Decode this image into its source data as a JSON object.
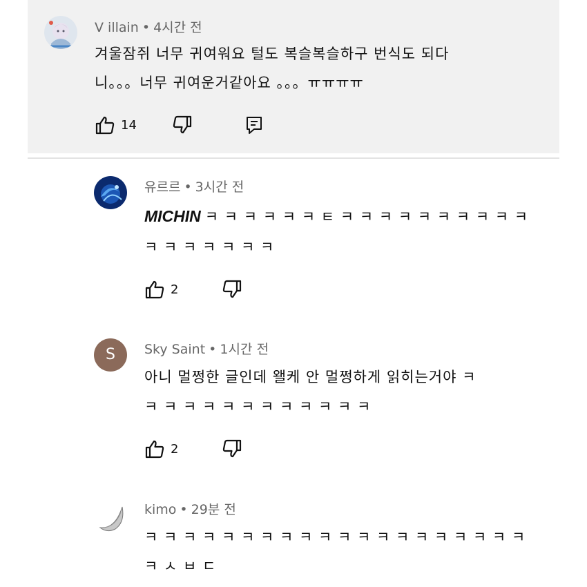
{
  "comments": [
    {
      "author": "V illain",
      "separator": "•",
      "time": "4시간 전",
      "lines": [
        "겨울잠쥐 너무 귀여워요 털도 복슬복슬하구 번식도 되다",
        "니。。。너무 귀여운거같아요 。。。ㅠㅠㅠㅠ"
      ],
      "likes": "14",
      "avatar_icon": "anime-character-avatar-icon"
    },
    {
      "author": "유르르",
      "separator": "•",
      "time": "3시간 전",
      "bold_word": "MICHIN",
      "lines": [
        "ㅋ ㅋ ㅋ ㅋ ㅋ ㅋ ㅌ ㅋ ㅋ ㅋ ㅋ ㅋ ㅋ ㅋ ㅋ ㅋ ㅋ",
        "ㅋ ㅋ ㅋ ㅋ ㅋ ㅋ ㅋ"
      ],
      "likes": "2",
      "avatar_icon": "blue-swirl-avatar-icon"
    },
    {
      "author": "Sky Saint",
      "separator": "•",
      "time": "1시간 전",
      "avatar_letter": "S",
      "lines": [
        "아니 멀쩡한 글인데 왤케 안 멀쩡하게 읽히는거야 ㅋ",
        "ㅋ ㅋ ㅋ ㅋ ㅋ ㅋ ㅋ ㅋ ㅋ ㅋ ㅋ ㅋ"
      ],
      "likes": "2",
      "avatar_color": "#8b6a5a"
    },
    {
      "author": "kimo",
      "separator": "•",
      "time": "29분 전",
      "lines": [
        "ㅋ ㅋ ㅋ ㅋ ㅋ ㅋ ㅋ ㅋ ㅋ ㅋ ㅋ ㅋ ㅋ ㅋ ㅋ ㅋ ㅋ ㅋ ㅋ ㅋ",
        "ㅋ ㅅ ㅂ ㄷ"
      ],
      "avatar_icon": "crescent-moon-avatar-icon"
    }
  ],
  "icons": {
    "like": "thumbs-up-icon",
    "dislike": "thumbs-down-icon",
    "reply": "reply-comment-icon"
  },
  "colors": {
    "highlight_bg": "#f1f1f1",
    "meta_text": "#666666",
    "body_text": "#111111"
  }
}
